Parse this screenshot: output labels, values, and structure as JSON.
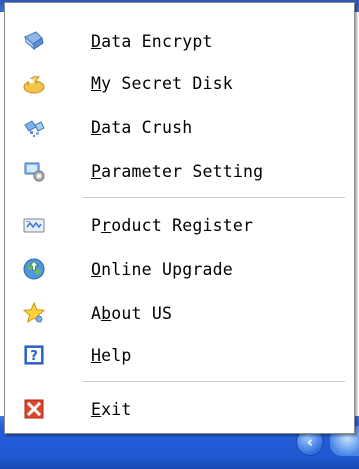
{
  "menu": {
    "items": [
      {
        "key": "D",
        "rest": "ata Encrypt",
        "icon": "encrypt-icon"
      },
      {
        "key": "M",
        "rest": "y Secret Disk",
        "icon": "secret-disk-icon"
      },
      {
        "key": "D",
        "rest": "ata Crush",
        "icon": "crush-icon"
      },
      {
        "key": "P",
        "rest": "arameter Setting",
        "icon": "settings-icon"
      },
      {
        "key": "P",
        "pre": "",
        "rest": "roduct Register",
        "underline_index": 1,
        "icon": "register-icon"
      },
      {
        "key": "O",
        "rest": "nline Upgrade",
        "icon": "upgrade-globe-icon"
      },
      {
        "key": "A",
        "rest": "bout US",
        "underline_index": 1,
        "icon": "about-star-icon"
      },
      {
        "key": "H",
        "rest": "elp",
        "icon": "help-icon"
      },
      {
        "key": "E",
        "rest": "xit",
        "icon": "exit-icon"
      }
    ],
    "labels": [
      "Data Encrypt",
      "My Secret Disk",
      "Data Crush",
      "Parameter Setting",
      "Product Register",
      "Online Upgrade",
      "About US",
      "Help",
      "Exit"
    ]
  },
  "taskbar": {
    "tray_arrow_glyph": "‹"
  },
  "colors": {
    "taskbar": "#245edb",
    "menu_bg": "#ffffff",
    "exit_red": "#e0452b"
  }
}
